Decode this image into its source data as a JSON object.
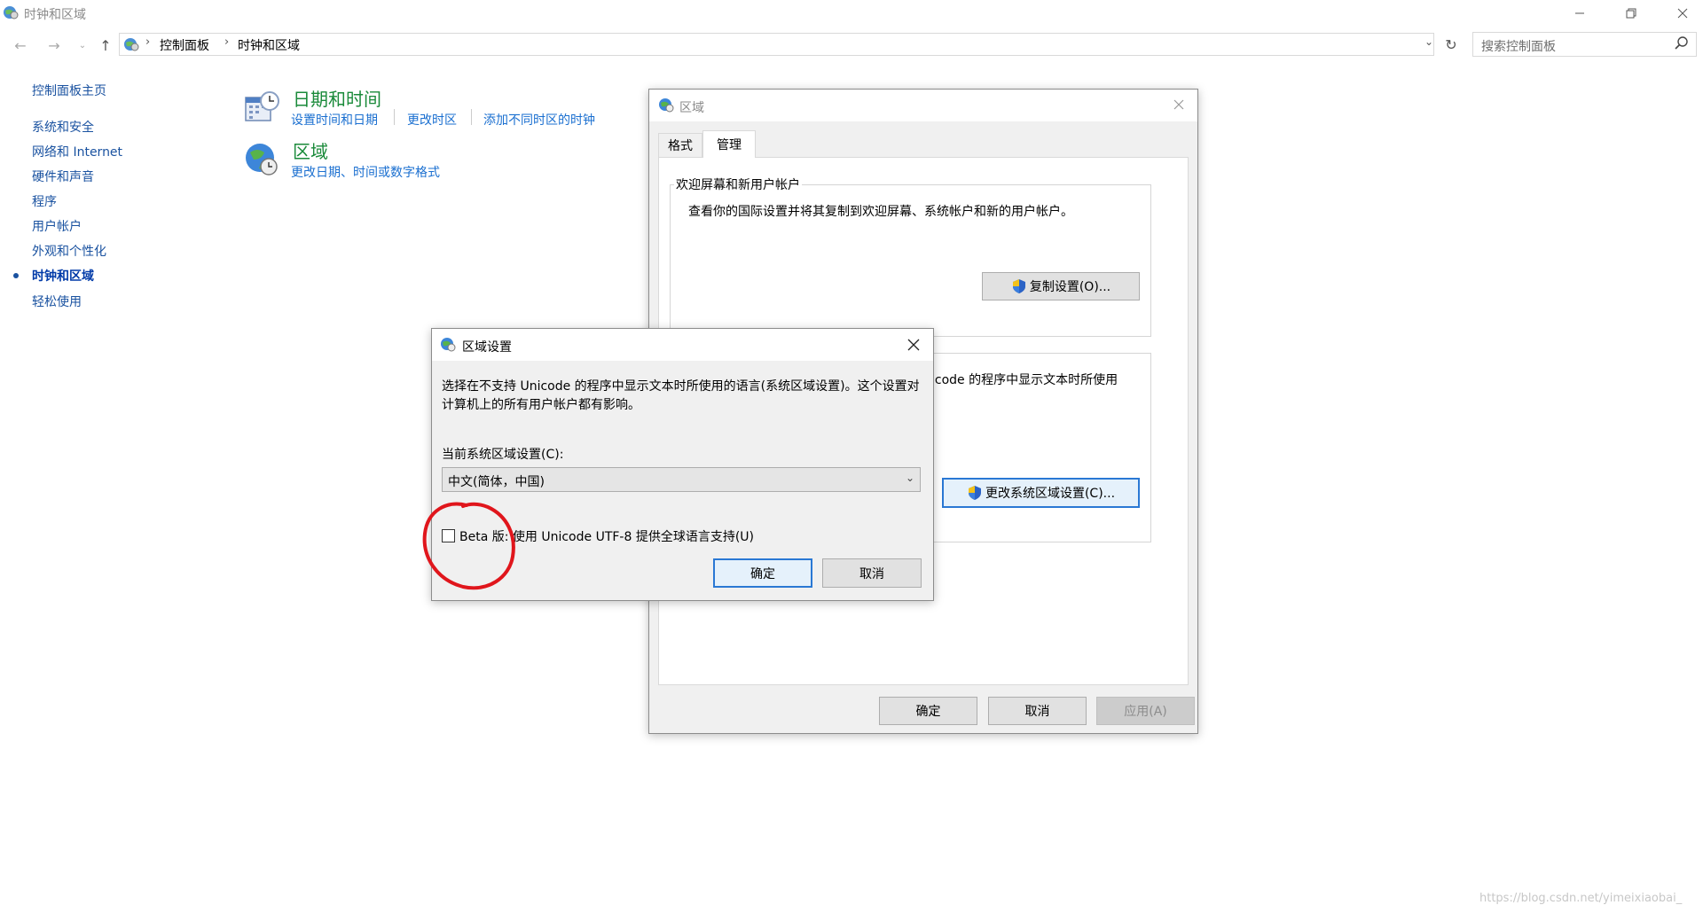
{
  "window": {
    "title": "时钟和区域",
    "controls": [
      "minimize",
      "restore",
      "close"
    ]
  },
  "address": {
    "breadcrumbs": [
      "控制面板",
      "时钟和区域"
    ],
    "search_placeholder": "搜索控制面板"
  },
  "sidebar": {
    "items": [
      {
        "label": "控制面板主页"
      },
      {
        "label": "系统和安全"
      },
      {
        "label": "网络和 Internet"
      },
      {
        "label": "硬件和声音"
      },
      {
        "label": "程序"
      },
      {
        "label": "用户帐户"
      },
      {
        "label": "外观和个性化"
      },
      {
        "label": "时钟和区域",
        "active": true
      },
      {
        "label": "轻松使用"
      }
    ]
  },
  "categories": [
    {
      "title": "日期和时间",
      "icon": "calendar-clock-icon",
      "links": [
        "设置时间和日期",
        "更改时区",
        "添加不同时区的时钟"
      ]
    },
    {
      "title": "区域",
      "icon": "globe-clock-icon",
      "links": [
        "更改日期、时间或数字格式"
      ]
    }
  ],
  "region_dialog": {
    "title": "区域",
    "tabs": [
      "格式",
      "管理"
    ],
    "active_tab": "管理",
    "welcome_group": {
      "label": "欢迎屏幕和新用户帐户",
      "text": "查看你的国际设置并将其复制到欢迎屏幕、系统帐户和新的用户帐户。",
      "button": "复制设置(O)..."
    },
    "nonunicode_group": {
      "text_partial": "icode 的程序中显示文本时所使用",
      "button": "更改系统区域设置(C)..."
    },
    "buttons": {
      "ok": "确定",
      "cancel": "取消",
      "apply": "应用(A)"
    }
  },
  "locale_dialog": {
    "title": "区域设置",
    "description": "选择在不支持 Unicode 的程序中显示文本时所使用的语言(系统区域设置)。这个设置对计算机上的所有用户帐户都有影响。",
    "current_label": "当前系统区域设置(C):",
    "current_value": "中文(简体，中国)",
    "beta_label": "Beta 版: 使用 Unicode UTF-8 提供全球语言支持(U)",
    "beta_checked": false,
    "buttons": {
      "ok": "确定",
      "cancel": "取消"
    }
  },
  "annotation": {
    "color": "#e0161c",
    "shape": "hand-drawn-circle"
  },
  "watermark": "https://blog.csdn.net/yimeixiaobai_"
}
